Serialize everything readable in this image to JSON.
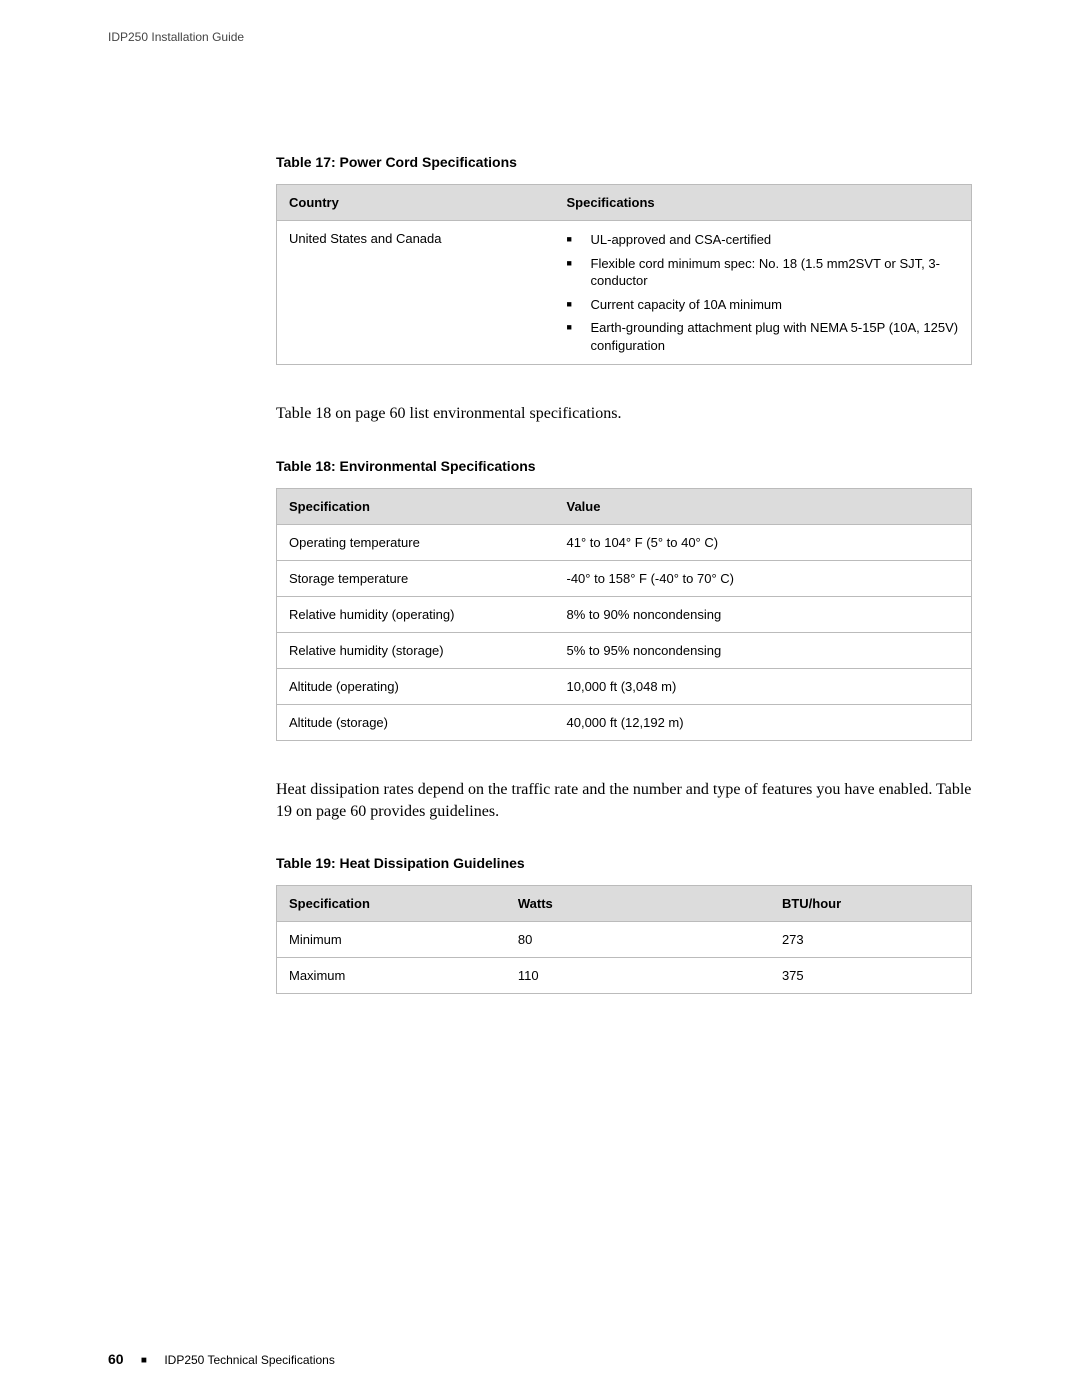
{
  "header": {
    "doc_title": "IDP250 Installation Guide"
  },
  "table17": {
    "caption": "Table 17: Power Cord Specifications",
    "headers": [
      "Country",
      "Specifications"
    ],
    "row": {
      "country": "United States and Canada",
      "specs": [
        "UL-approved and CSA-certified",
        "Flexible cord minimum spec: No. 18 (1.5 mm2SVT or SJT, 3-conductor",
        "Current capacity of 10A minimum",
        "Earth-grounding attachment plug with NEMA 5-15P (10A, 125V) configuration"
      ]
    }
  },
  "para1": "Table 18 on page 60 list environmental specifications.",
  "table18": {
    "caption": "Table 18: Environmental Specifications",
    "headers": [
      "Specification",
      "Value"
    ],
    "rows": [
      {
        "spec": "Operating temperature",
        "value": "41° to 104° F (5° to 40° C)"
      },
      {
        "spec": "Storage temperature",
        "value": "-40° to 158° F (-40° to 70° C)"
      },
      {
        "spec": "Relative humidity (operating)",
        "value": "8% to 90% noncondensing"
      },
      {
        "spec": "Relative humidity (storage)",
        "value": "5% to 95% noncondensing"
      },
      {
        "spec": "Altitude (operating)",
        "value": "10,000 ft (3,048 m)"
      },
      {
        "spec": "Altitude (storage)",
        "value": "40,000 ft (12,192 m)"
      }
    ]
  },
  "para2": "Heat dissipation rates depend on the traffic rate and the number and type of features you have enabled. Table 19 on page 60 provides guidelines.",
  "table19": {
    "caption": "Table 19: Heat Dissipation Guidelines",
    "headers": [
      "Specification",
      "Watts",
      "BTU/hour"
    ],
    "rows": [
      {
        "spec": "Minimum",
        "watts": "80",
        "btu": "273"
      },
      {
        "spec": "Maximum",
        "watts": "110",
        "btu": "375"
      }
    ]
  },
  "footer": {
    "page": "60",
    "section": "IDP250 Technical Specifications"
  }
}
